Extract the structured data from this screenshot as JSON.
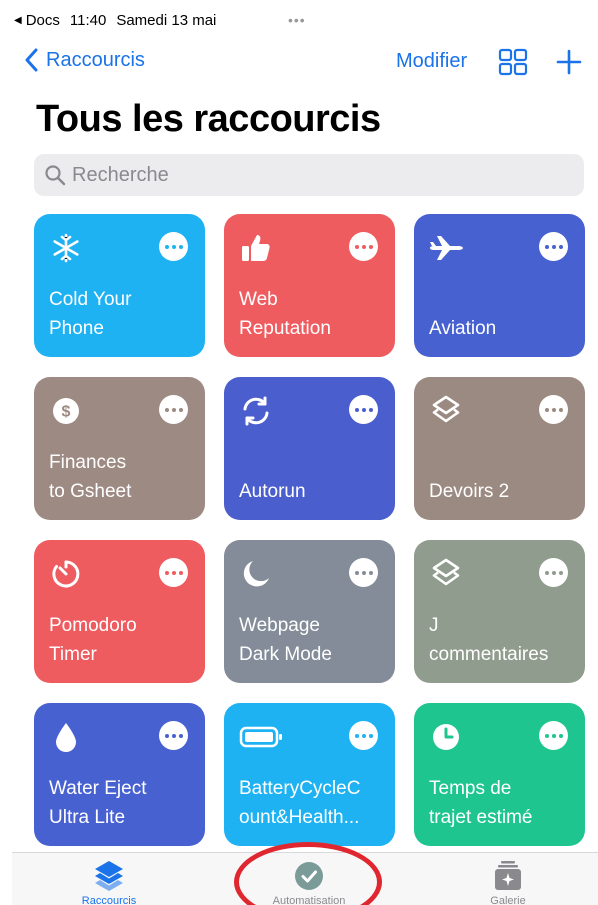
{
  "status_bar": {
    "back_app": "Docs",
    "time": "11:40",
    "date": "Samedi 13 mai",
    "dots": "•••"
  },
  "nav": {
    "back_label": "Raccourcis",
    "edit_label": "Modifier"
  },
  "page_title": "Tous les raccourcis",
  "search": {
    "placeholder": "Recherche"
  },
  "colors": {
    "accent": "#1a73e8",
    "annotation": "#e0262e"
  },
  "shortcuts": [
    {
      "name": "Cold Your\nPhone",
      "icon": "snowflake-icon",
      "color": "#1fb2f2"
    },
    {
      "name": "Web\nReputation",
      "icon": "thumbs-up-icon",
      "color": "#ee5c60"
    },
    {
      "name": "Aviation",
      "icon": "airplane-icon",
      "color": "#4861d1"
    },
    {
      "name": "Finances\nto Gsheet",
      "icon": "dollar-icon",
      "color": "#9d8a82"
    },
    {
      "name": "Autorun",
      "icon": "sync-icon",
      "color": "#4b5ecd"
    },
    {
      "name": "Devoirs 2",
      "icon": "layers-icon",
      "color": "#9b8a81"
    },
    {
      "name": "Pomodoro\nTimer",
      "icon": "timer-icon",
      "color": "#ee5c60"
    },
    {
      "name": "Webpage\nDark Mode",
      "icon": "moon-icon",
      "color": "#838c98"
    },
    {
      "name": "J\ncommentaires",
      "icon": "layers-icon",
      "color": "#909c8d"
    },
    {
      "name": "Water Eject\nUltra Lite",
      "icon": "drop-icon",
      "color": "#4861d1"
    },
    {
      "name": "BatteryCycleC\nount&Health...",
      "icon": "battery-icon",
      "color": "#1fb2f2"
    },
    {
      "name": "Temps de\ntrajet estimé",
      "icon": "clock-icon",
      "color": "#1fc58e"
    }
  ],
  "tabs": [
    {
      "label": "Raccourcis",
      "icon": "layers-icon",
      "active": true
    },
    {
      "label": "Automatisation",
      "icon": "check-clock-icon",
      "active": false
    },
    {
      "label": "Galerie",
      "icon": "gallery-icon",
      "active": false
    }
  ]
}
